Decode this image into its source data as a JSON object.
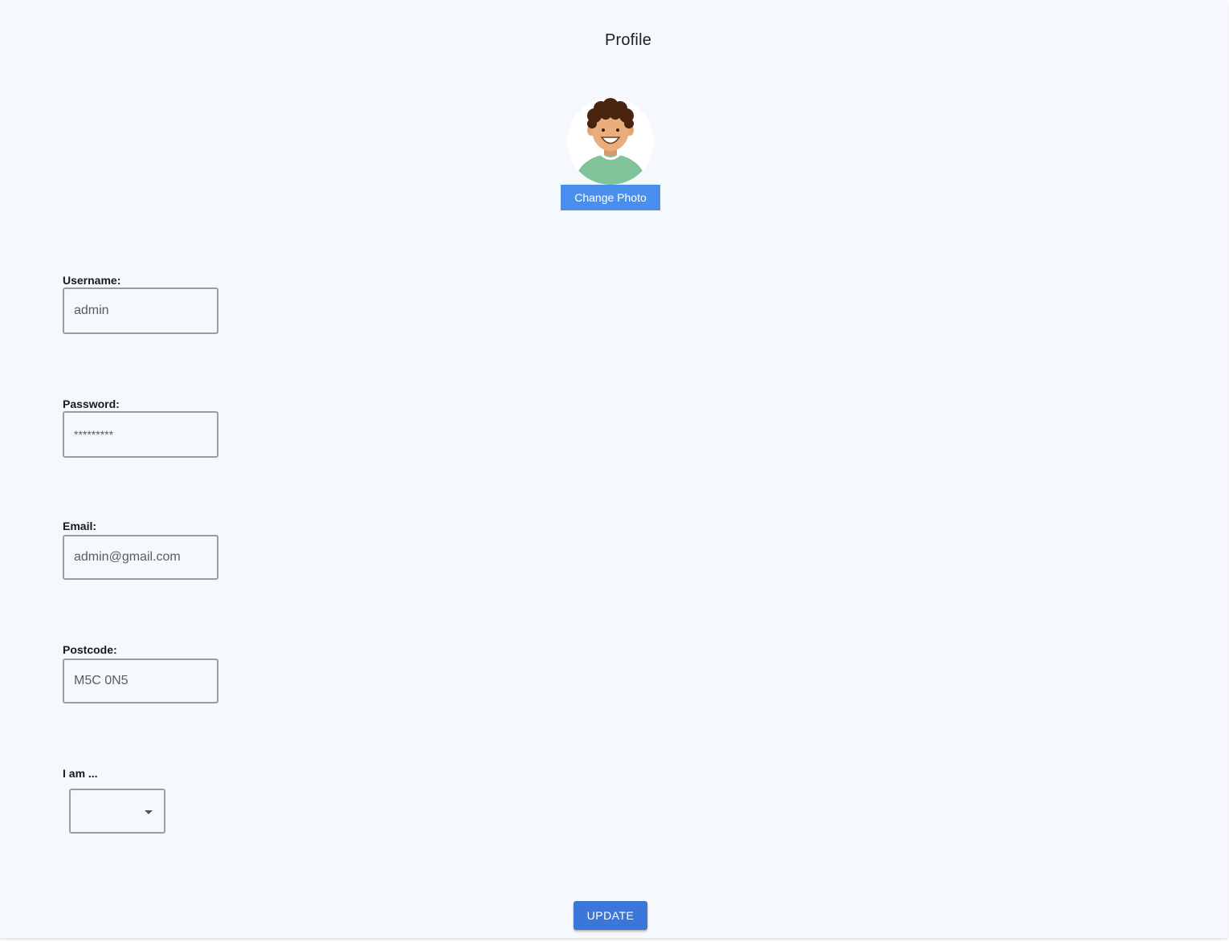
{
  "page": {
    "title": "Profile"
  },
  "avatar": {
    "icon": "avatar-icon",
    "change_photo_label": "Change Photo"
  },
  "form": {
    "username": {
      "label": "Username:",
      "value": "admin"
    },
    "password": {
      "label": "Password:",
      "value": "*********"
    },
    "email": {
      "label": "Email:",
      "value": "admin@gmail.com"
    },
    "postcode": {
      "label": "Postcode:",
      "value": "M5C 0N5"
    },
    "role": {
      "label": "I am ...",
      "selected": ""
    }
  },
  "actions": {
    "update_label": "UPDATE"
  },
  "colors": {
    "background": "#f5f8fc",
    "change_photo_button": "#4a8fee",
    "update_button": "#3a77d8",
    "input_border": "#9a9ea3"
  }
}
